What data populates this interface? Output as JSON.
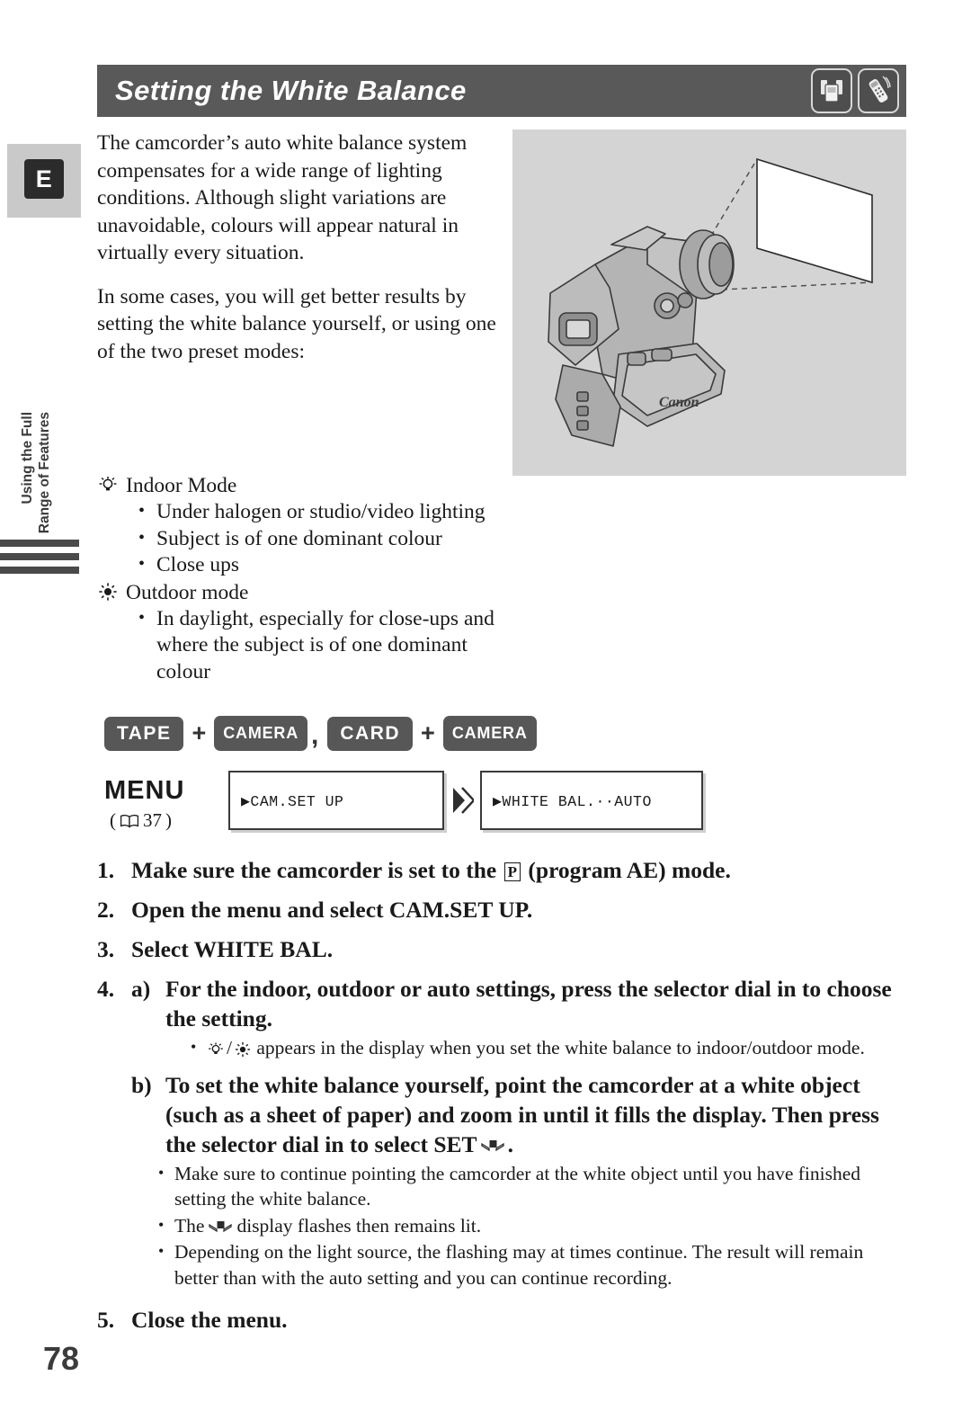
{
  "page": {
    "number": "78",
    "language_tab": "E",
    "side_caption_line1": "Using the Full",
    "side_caption_line2": "Range of Features"
  },
  "header": {
    "title": "Setting the White Balance",
    "icons": [
      "tape-cassette-icon",
      "card-remote-icon"
    ]
  },
  "intro": {
    "paragraph1": "The camcorder’s auto white balance system compensates for a wide range of lighting conditions. Although slight variations are unavoidable, colours will appear natural in virtually every situation.",
    "paragraph2": "In some cases, you will get better results by setting the white balance yourself, or using one of the two preset modes:"
  },
  "modes": [
    {
      "icon": "indoor-bulb-icon",
      "label": "Indoor Mode",
      "bullets": [
        "Under halogen or studio/video lighting",
        "Subject is of one dominant colour",
        "Close ups"
      ]
    },
    {
      "icon": "outdoor-sun-icon",
      "label": "Outdoor mode",
      "bullets": [
        "In daylight, especially for close-ups and where the subject is of one dominant colour"
      ]
    }
  ],
  "operating_modes": {
    "badge1": "TAPE",
    "plus1": "+",
    "badge2": "CAMERA",
    "separator": ",",
    "badge3": "CARD",
    "plus2": "+",
    "badge4": "CAMERA"
  },
  "menu": {
    "label": "MENU",
    "ref_open": "(",
    "ref_page": "37",
    "ref_close": ")",
    "screen1": "▶CAM.SET UP",
    "screen2": "▶WHITE BAL.··AUTO"
  },
  "steps": [
    {
      "number": "1.",
      "text_before": "Make sure the camcorder is set to the",
      "symbol": "P",
      "text_after": "(program AE) mode."
    },
    {
      "number": "2.",
      "text": "Open the menu and select CAM.SET UP."
    },
    {
      "number": "3.",
      "text": "Select WHITE BAL."
    }
  ],
  "step4": {
    "number": "4.",
    "a": {
      "label": "a)",
      "text": "For the indoor, outdoor or auto settings, press the selector dial in to choose the setting.",
      "notes_prefix": "",
      "note_text": "appears in the display when you set the white balance to indoor/outdoor mode."
    },
    "b": {
      "label": "b)",
      "text_before": "To set the white balance yourself, point the camcorder at a white object (such as a sheet of paper) and zoom in until it fills the display. Then press the selector dial in to select SET",
      "text_after": ".",
      "notes": [
        "Make sure to continue pointing the camcorder at the white object until you have finished setting the white balance.",
        "Depending on the light source, the flashing may at times continue. The result will remain better than with the auto setting and you can continue recording."
      ],
      "note_flash_before": "The",
      "note_flash_after": "display flashes then remains lit."
    }
  },
  "step5": {
    "number": "5.",
    "text": "Close the menu."
  },
  "figure": {
    "brand": "Canon",
    "description": "camcorder-pointing-at-white-sheet"
  },
  "colors": {
    "title_bar": "#595959",
    "badge": "#575757",
    "figure_bg": "#d4d4d4",
    "tab_bg": "#c9c9c9"
  }
}
